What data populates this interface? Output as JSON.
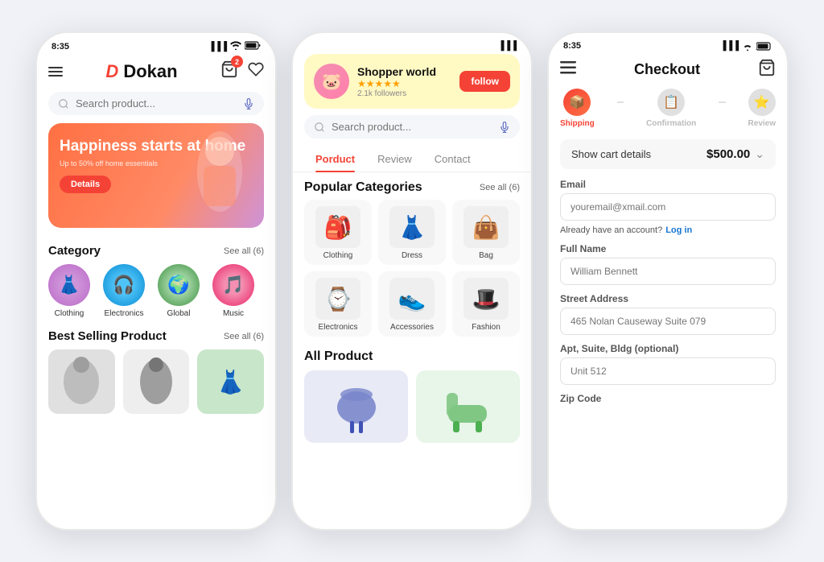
{
  "phone1": {
    "status_time": "8:35",
    "logo": "Dokan",
    "logo_d": "D",
    "cart_badge": "2",
    "search_placeholder": "Search product...",
    "banner": {
      "title": "Happiness starts at home",
      "subtitle": "Up to 50% off home essentials",
      "btn_label": "Details"
    },
    "category_section": {
      "title": "Category",
      "see_all": "See all (6)",
      "items": [
        {
          "label": "Clothing",
          "emoji": "👗",
          "color": "#e1bee7"
        },
        {
          "label": "Electronics",
          "emoji": "🎧",
          "color": "#b3e5fc"
        },
        {
          "label": "Global",
          "emoji": "🌍",
          "color": "#c8e6c9"
        },
        {
          "label": "Music",
          "emoji": "🎵",
          "color": "#f8bbd0"
        }
      ]
    },
    "best_selling": {
      "title": "Best Selling Product",
      "see_all": "See all (6)",
      "items": [
        "🧥",
        "🕴️",
        "👗"
      ]
    }
  },
  "phone2": {
    "store": {
      "name": "Shopper world",
      "stars": "★★★★★",
      "followers": "2.1k followers",
      "follow_btn": "follow"
    },
    "search_placeholder": "Search product...",
    "tabs": [
      "Porduct",
      "Review",
      "Contact"
    ],
    "active_tab": 0,
    "popular_categories": {
      "title": "Popular Categories",
      "see_all": "See all (6)",
      "items": [
        {
          "label": "Clothing",
          "emoji": "🎒"
        },
        {
          "label": "Dress",
          "emoji": "👗"
        },
        {
          "label": "Bag",
          "emoji": "👜"
        },
        {
          "label": "Electronics",
          "emoji": "⌚"
        },
        {
          "label": "Accessories",
          "emoji": "👟"
        },
        {
          "label": "Fashion",
          "emoji": "🎩"
        }
      ]
    },
    "all_product": {
      "title": "All Product",
      "items": [
        "🪑",
        "🛋️"
      ]
    }
  },
  "phone3": {
    "status_time": "8:35",
    "title": "Checkout",
    "steps": [
      {
        "label": "Shipping",
        "active": true,
        "icon": "📦"
      },
      {
        "label": "Confirmation",
        "active": false,
        "icon": "📋"
      },
      {
        "label": "Review",
        "active": false,
        "icon": "⭐"
      }
    ],
    "cart_summary": {
      "label": "Show cart details",
      "price": "$500.00"
    },
    "form": {
      "email_label": "Email",
      "email_placeholder": "youremail@xmail.com",
      "account_text": "Already have an account?",
      "login_label": "Log in",
      "fullname_label": "Full Name",
      "fullname_placeholder": "William Bennett",
      "street_label": "Street Address",
      "street_placeholder": "465 Nolan Causeway Suite 079",
      "apt_label": "Apt, Suite, Bldg (optional)",
      "apt_placeholder": "Unit 512",
      "zip_label": "Zip Code"
    }
  }
}
